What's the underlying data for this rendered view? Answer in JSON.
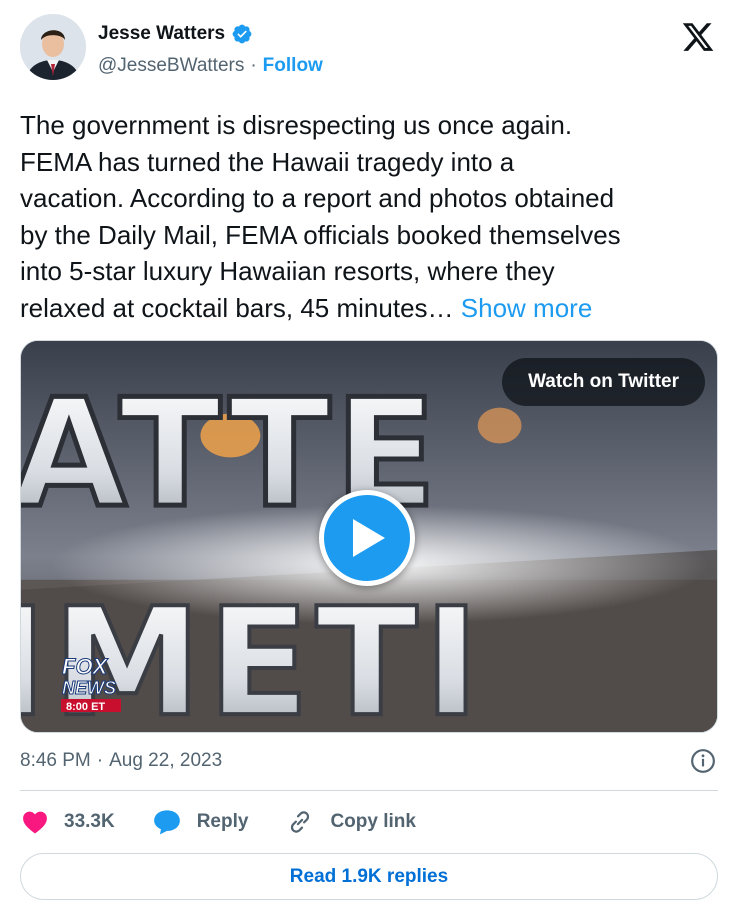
{
  "author": {
    "name": "Jesse Watters",
    "handle": "@JesseBWatters",
    "separator": "·",
    "follow_label": "Follow"
  },
  "icons": {
    "logo": "x-logo-icon",
    "verified": "verified-badge-icon",
    "play": "play-icon",
    "info": "info-icon",
    "like": "heart-icon",
    "reply": "speech-bubble-icon",
    "copy": "link-icon"
  },
  "tweet": {
    "lines": [
      "The government is disrespecting us once again.",
      "FEMA has turned the Hawaii tragedy into a",
      "vacation. According to a report and photos obtained",
      "by the Daily Mail, FEMA officials booked themselves",
      "into 5-star luxury Hawaiian resorts, where they",
      "relaxed at cocktail bars, 45 minutes…"
    ],
    "show_more_label": "Show more"
  },
  "media": {
    "watch_label": "Watch on Twitter",
    "headline_line1": "ATTE",
    "headline_line2": "IMETI",
    "network_logo": {
      "line1": "FOX",
      "line2": "NEWS",
      "time": "8:00 ET"
    }
  },
  "meta": {
    "time": "8:46 PM",
    "separator": "·",
    "date": "Aug 22, 2023"
  },
  "actions": {
    "likes": "33.3K",
    "reply_label": "Reply",
    "copy_label": "Copy link"
  },
  "read_replies_label": "Read 1.9K replies",
  "colors": {
    "accent": "#1d9bf0",
    "link": "#006fd6",
    "text": "#0f1419",
    "muted": "#536471",
    "like": "#f91880",
    "border": "#cfd9de"
  }
}
